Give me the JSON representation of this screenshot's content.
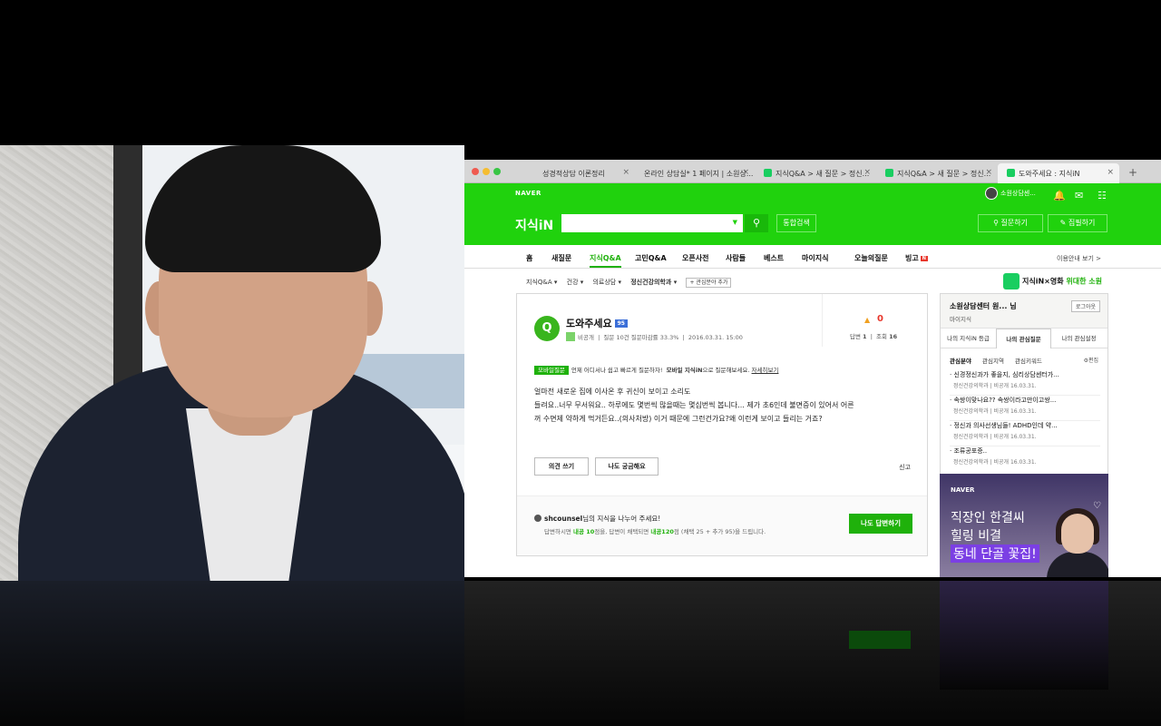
{
  "browser": {
    "tabs": [
      {
        "label": "성경적상담 이론정리"
      },
      {
        "label": "온라인 상담실* 1 페이지 | 소원상..."
      },
      {
        "label": "지식Q&A > 새 질문 > 정신..."
      },
      {
        "label": "지식Q&A > 새 질문 > 정신..."
      },
      {
        "label": "도와주세요 : 지식iN"
      }
    ],
    "new_tab": "+"
  },
  "header": {
    "naver": "NAVER",
    "logo": "지식iN",
    "search_placeholder": "",
    "search_icon": "search-icon",
    "integrated_search": "통합검색",
    "user": "소원상담센...",
    "ask": "질문하기",
    "write": "집필하기"
  },
  "gnb": {
    "items": [
      "홈",
      "새질문",
      "지식Q&A",
      "고민Q&A",
      "오픈사전",
      "사람들",
      "베스트",
      "마이지식",
      "오늘의질문",
      "빙고"
    ],
    "bingo_badge": "N",
    "info": "이용안내 보기 >"
  },
  "breadcrumb": {
    "items": [
      "지식Q&A ▾",
      "건강 ▾",
      "의료상담 ▾",
      "정신건강의학과 ▾"
    ],
    "add": "+ 관심분야 추가"
  },
  "promo": {
    "text": "지식iN×영화",
    "highlight": "위대한 소원"
  },
  "question": {
    "icon": "Q",
    "title": "도와주세요",
    "badge": "95",
    "author": "비공개",
    "meta": "질문 10건  질문마감률 33.3%",
    "date": "2016.03.31. 15:00",
    "likes": "0",
    "answers_label": "답변",
    "answers": "1",
    "views_label": "조회",
    "views": "16",
    "mobile_tag": "모바일질문",
    "mobile_text": "언제 어디서나 쉽고 빠르게 질문하자!",
    "mobile_app": "모바일 지식iN",
    "mobile_suffix": "으로 질문해보세요.",
    "mobile_link": "자세히보기",
    "body_1": "얼마전 새로운 집에 이사온 후 귀신이 보이고 소리도",
    "body_2": "들려요..너무 무서워요.. 하루에도 몇번씩 많을때는 몇십번씩 봅니다... 제가 초6인데 불면증이 있어서 어른",
    "body_3": "꺼 수면제 약하게 먹거든요..(의사처방) 이거 때문에 그런건가요?왜 이런게 보이고 들리는 거죠?",
    "opinion_btn": "의견 쓰기",
    "curious_btn": "나도 궁금해요",
    "report": "신고"
  },
  "answer": {
    "user": "shcounsel",
    "line1_suffix": "님의 지식을 나누어 주세요!",
    "line2_pre": "답변하시면 ",
    "points1": "내공 10",
    "line2_mid": "점을, 답변이 채택되면 ",
    "points2": "내공120",
    "line2_post": "점 (채택 25 + 추가 95)을 드립니다.",
    "button": "나도 답변하기"
  },
  "sidebar": {
    "name": "소원상담센터 원... 님",
    "sub": "마이지식",
    "logout": "로그아웃",
    "tabs": [
      "나의 지식iN 등급",
      "나의 관심질문",
      "나의 관심설정"
    ],
    "sub_tabs": [
      "관심분야",
      "관심지역",
      "관심키워드"
    ],
    "edit": "편집",
    "items": [
      {
        "title": "· 신경정신과가 좋을지, 심리상담센터가...",
        "meta": "정신건강의학과 | 비공개   16.03.31."
      },
      {
        "title": "· 속쌍이맞나요?? 속쌍이라고만이고쌍...",
        "meta": "정신건강의학과 | 비공개   16.03.31."
      },
      {
        "title": "· 정신과 의사선생님들! ADHD인데 약...",
        "meta": "정신건강의학과 | 비공개   16.03.31."
      },
      {
        "title": "· 조류공포증..",
        "meta": "정신건강의학과 | 비공개   16.03.31."
      }
    ]
  },
  "ad": {
    "brand": "NAVER",
    "line1": "직장인 한결씨",
    "line2": "힐링 비결",
    "line3": "동네 단골 꽃집!"
  },
  "colors": {
    "naver_green": "#20d20d",
    "accent_green": "#1fb10b",
    "badge_red": "#e8372c"
  }
}
